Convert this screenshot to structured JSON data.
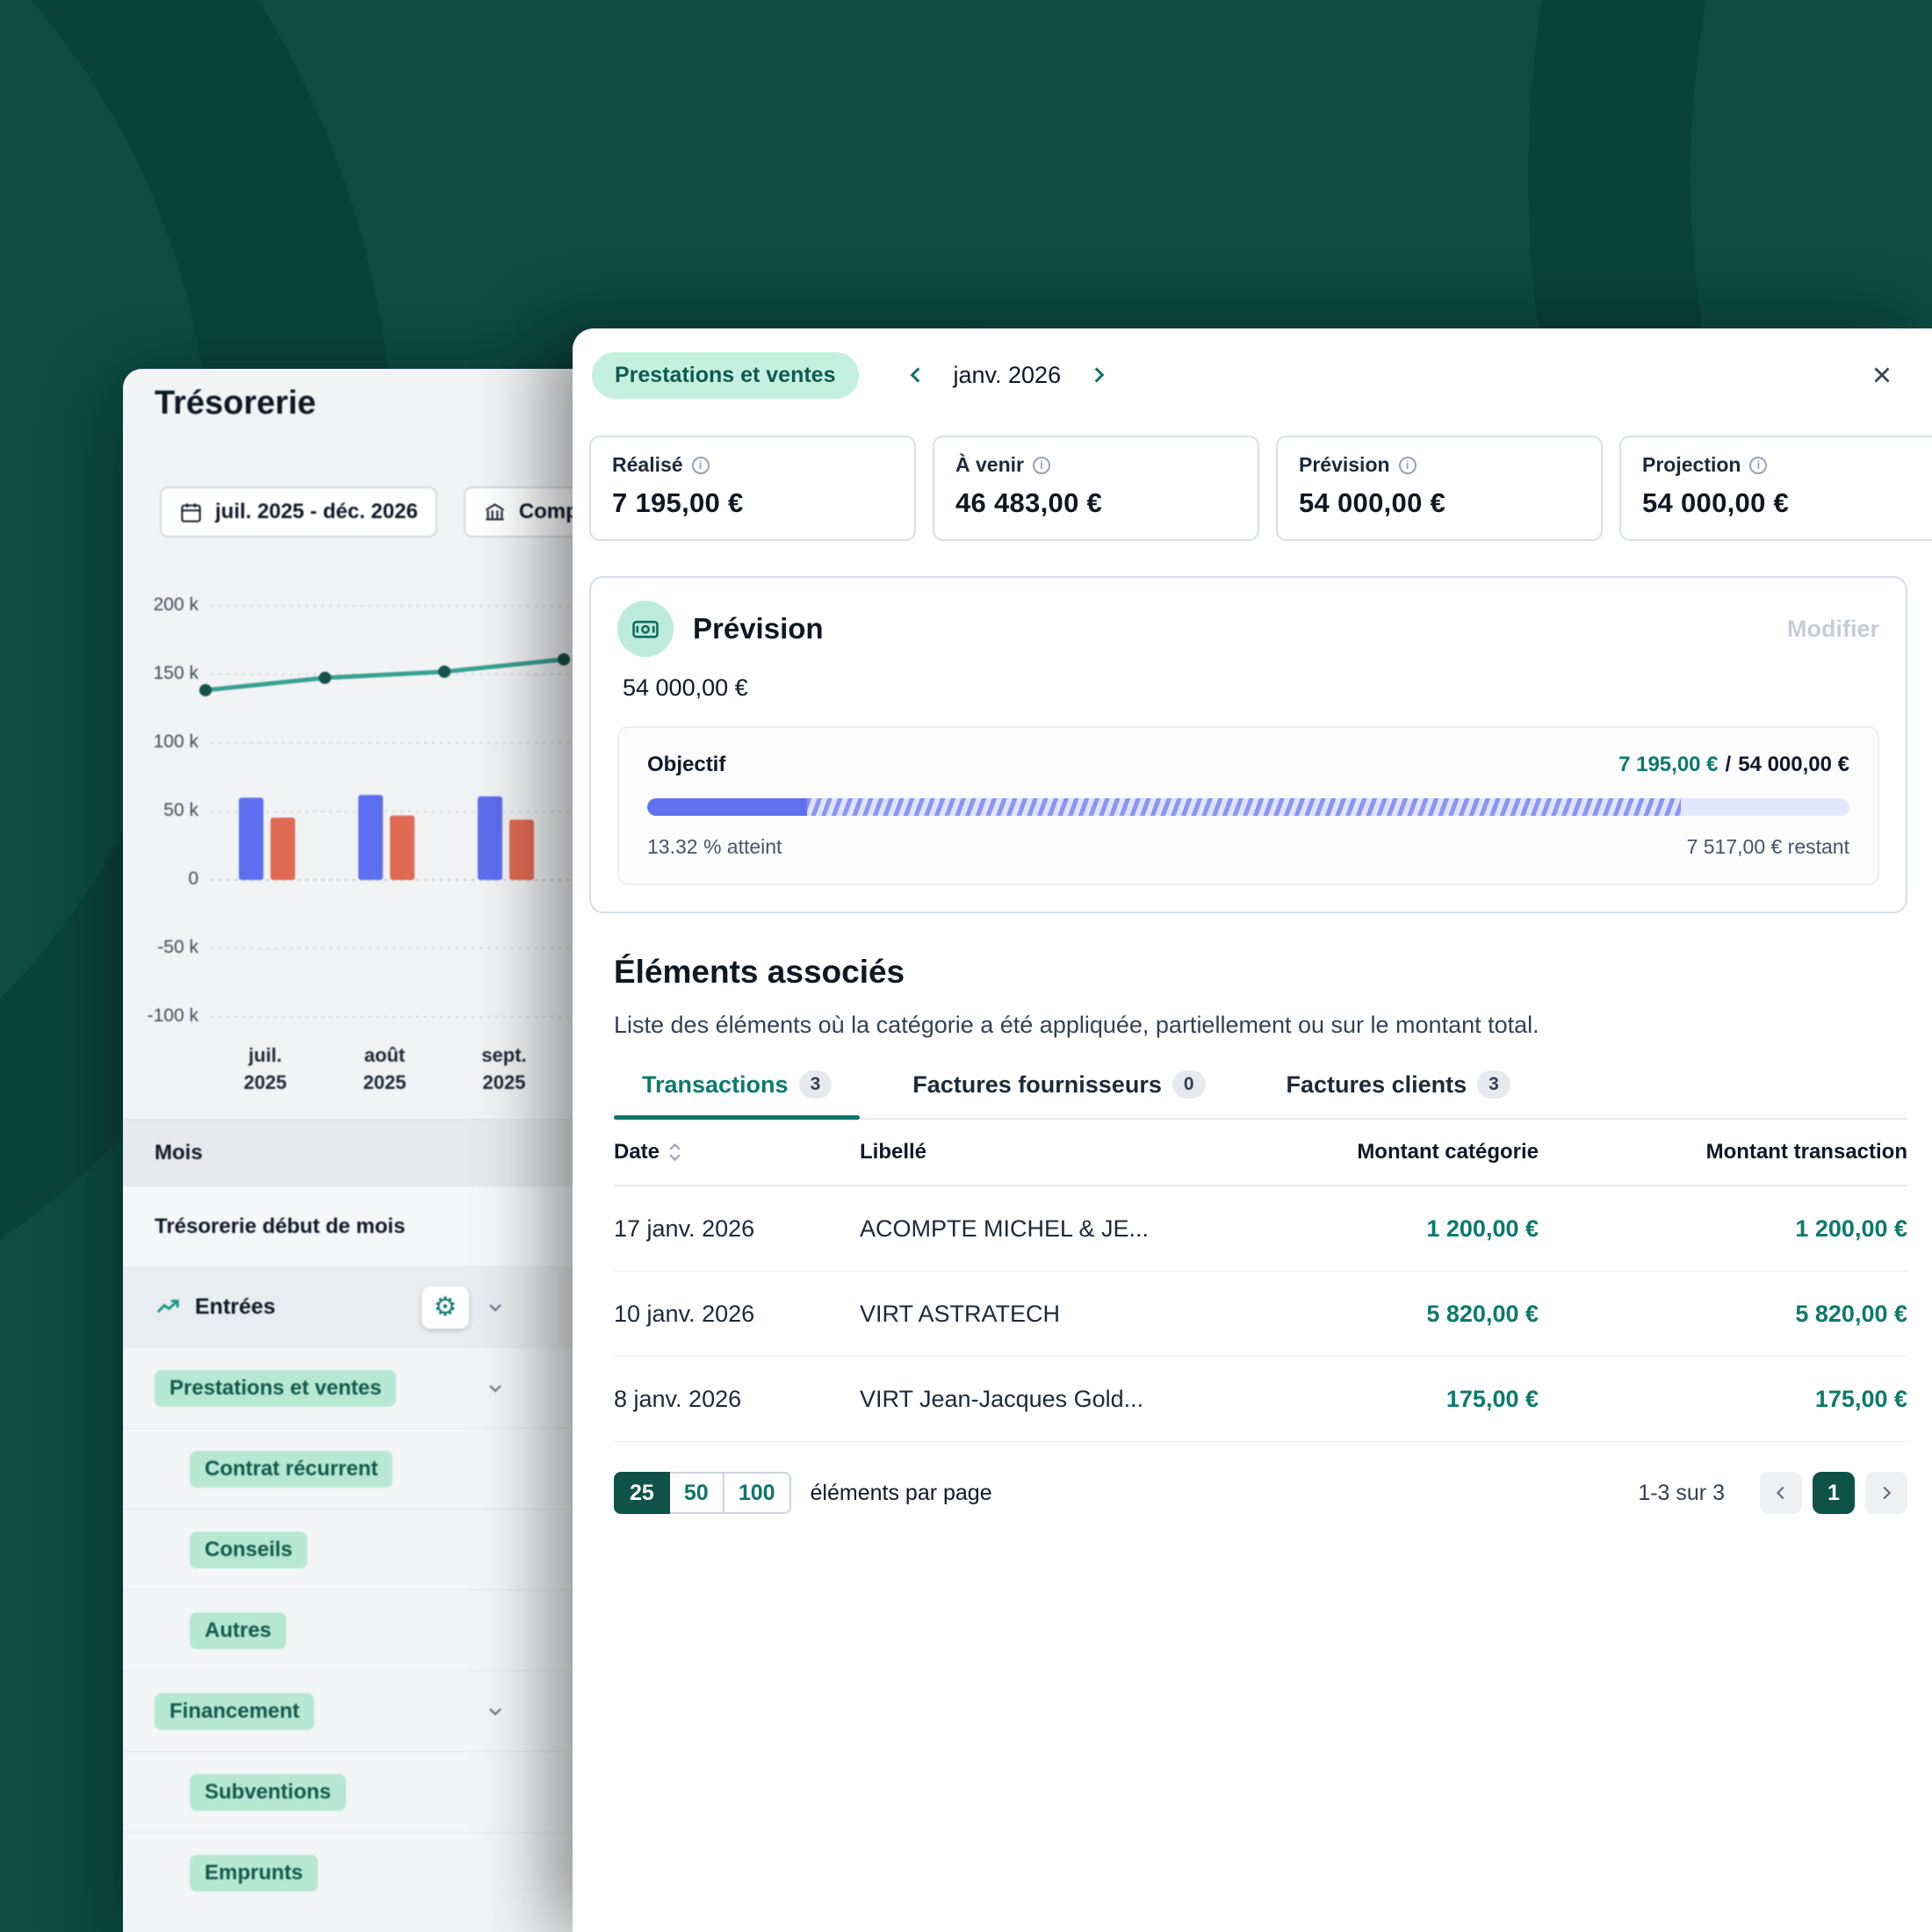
{
  "colors": {
    "background": "#0d4b43",
    "mint_highlight": "#b7e8d4",
    "teal_accent": "#0e7569",
    "amount_teal": "#0c7a6b",
    "progress_blue": "#6070f1",
    "bar_blue": "#5d6ef0",
    "bar_red": "#e06a54",
    "line_teal": "#37a08e"
  },
  "background_window": {
    "title": "Trésorerie",
    "date_range_button": "juil. 2025 - déc. 2026",
    "accounts_button": "Comp",
    "y_axis": [
      "200 k",
      "150 k",
      "100 k",
      "50 k",
      "0",
      "-50 k",
      "-100 k"
    ],
    "x_axis": [
      {
        "month": "juil.",
        "year": "2025"
      },
      {
        "month": "août",
        "year": "2025"
      },
      {
        "month": "sept.",
        "year": "2025"
      }
    ],
    "rows": [
      {
        "label": "Mois"
      },
      {
        "label": "Trésorerie début de mois"
      },
      {
        "label": "Entrées"
      },
      {
        "label": "Prestations et ventes"
      },
      {
        "label": "Contrat récurrent"
      },
      {
        "label": "Conseils"
      },
      {
        "label": "Autres"
      },
      {
        "label": "Financement"
      },
      {
        "label": "Subventions"
      },
      {
        "label": "Emprunts"
      }
    ]
  },
  "panel": {
    "category_badge": "Prestations et ventes",
    "month_label": "janv. 2026",
    "stats": [
      {
        "label": "Réalisé",
        "value": "7 195,00 €"
      },
      {
        "label": "À venir",
        "value": "46 483,00 €"
      },
      {
        "label": "Prévision",
        "value": "54 000,00 €"
      },
      {
        "label": "Projection",
        "value": "54 000,00 €"
      }
    ],
    "prevision_card": {
      "title": "Prévision",
      "amount": "54 000,00 €",
      "edit_label": "Modifier",
      "objective_label": "Objectif",
      "achieved_amount": "7 195,00 €",
      "separator": "/",
      "target_amount": "54 000,00 €",
      "percent_text": "13.32 % atteint",
      "remaining_text": "7 517,00 € restant",
      "achieved_percent": 13.32,
      "projected_percent": 86
    },
    "associated": {
      "title": "Éléments associés",
      "description": "Liste des éléments où la catégorie a été appliquée, partiellement ou sur le montant total.",
      "tabs": [
        {
          "label": "Transactions",
          "count": "3"
        },
        {
          "label": "Factures fournisseurs",
          "count": "0"
        },
        {
          "label": "Factures clients",
          "count": "3"
        }
      ],
      "table": {
        "headers": [
          "Date",
          "Libellé",
          "Montant catégorie",
          "Montant transaction"
        ],
        "rows": [
          {
            "date": "17 janv. 2026",
            "label": "ACOMPTE MICHEL & JE...",
            "category_amount": "1 200,00 €",
            "transaction_amount": "1 200,00 €"
          },
          {
            "date": "10 janv. 2026",
            "label": "VIRT ASTRATECH",
            "category_amount": "5 820,00 €",
            "transaction_amount": "5 820,00 €"
          },
          {
            "date": "8 janv. 2026",
            "label": "VIRT Jean-Jacques Gold...",
            "category_amount": "175,00 €",
            "transaction_amount": "175,00 €"
          }
        ]
      },
      "pagination": {
        "sizes": [
          "25",
          "50",
          "100"
        ],
        "active_size": "25",
        "per_page_label": "éléments par page",
        "range_label": "1-3 sur 3",
        "current_page": "1"
      }
    }
  },
  "chart_data": {
    "type": "bar",
    "title": "Trésorerie",
    "categories": [
      "juil. 2025",
      "août 2025",
      "sept. 2025"
    ],
    "series": [
      {
        "name": "solde-tresorerie-ligne",
        "type": "line",
        "values": [
          138500,
          147500,
          152000,
          161000
        ]
      },
      {
        "name": "entrees-barres-bleues",
        "type": "bar",
        "values": [
          60000,
          62000,
          61000
        ]
      },
      {
        "name": "sorties-barres-rouges",
        "type": "bar",
        "values": [
          45500,
          47000,
          44000
        ]
      }
    ],
    "ylim": [
      -100000,
      200000
    ],
    "y_ticks": [
      "200 k",
      "150 k",
      "100 k",
      "50 k",
      "0",
      "-50 k",
      "-100 k"
    ],
    "grid": "dotted-horizontal",
    "legend": "none",
    "note": "chart partially hidden behind overlay panel; line series has a 4th point at the panel edge"
  }
}
